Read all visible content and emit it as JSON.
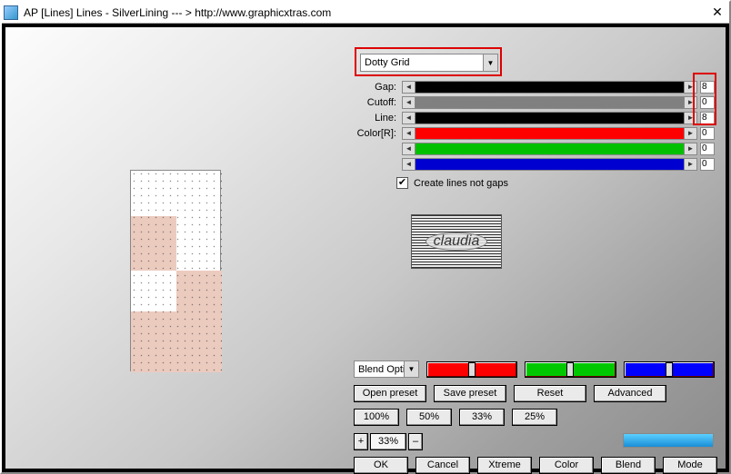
{
  "window": {
    "title": "AP [Lines]  Lines - SilverLining   --- > http://www.graphicxtras.com"
  },
  "preset": {
    "selected": "Dotty Grid"
  },
  "params": {
    "gap": {
      "label": "Gap:",
      "value": "8",
      "fill": "#000000"
    },
    "cutoff": {
      "label": "Cutoff:",
      "value": "0",
      "fill": "#808080"
    },
    "line": {
      "label": "Line:",
      "value": "8",
      "fill": "#000000"
    },
    "colorR": {
      "label": "Color[R]:",
      "value": "0",
      "fill": "#ff0000"
    },
    "colorG": {
      "label": "",
      "value": "0",
      "fill": "#00c000"
    },
    "colorB": {
      "label": "",
      "value": "0",
      "fill": "#0000d0"
    }
  },
  "checkbox": {
    "create_lines_not_gaps": {
      "label": "Create lines not gaps",
      "checked": true
    }
  },
  "logo_text": "claudia",
  "blend": {
    "dropdown_label": "Blend Optio",
    "r_color": "#ff0000",
    "g_color": "#00c000",
    "b_color": "#0000ff"
  },
  "buttons": {
    "open_preset": "Open preset",
    "save_preset": "Save preset",
    "reset": "Reset",
    "advanced": "Advanced",
    "p100": "100%",
    "p50": "50%",
    "p33": "33%",
    "p25": "25%",
    "plus": "+",
    "minus": "–",
    "zoom_value": "33%",
    "ok": "OK",
    "cancel": "Cancel",
    "xtreme": "Xtreme",
    "color": "Color",
    "blend": "Blend",
    "mode": "Mode"
  },
  "progress_pct": 100
}
